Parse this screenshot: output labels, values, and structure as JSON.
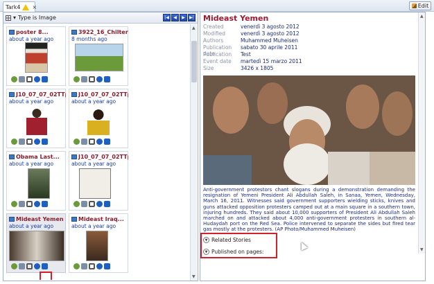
{
  "tab": {
    "label": "Tark4",
    "close": "×"
  },
  "toolbar": {
    "edit_label": "Edit"
  },
  "filter": {
    "label": "Type is Image",
    "prev_first": "|◀",
    "prev": "◀",
    "next": "▶",
    "next_last": "▶|"
  },
  "cards": [
    {
      "title": "poster 8...",
      "age": "about a year ago"
    },
    {
      "title": "3922_16_Chilterns_...",
      "age": "8 months ago"
    },
    {
      "title": "J10_07_07_02TTp0...",
      "age": "about a year ago"
    },
    {
      "title": "J10_07_07_02TTp0...",
      "age": "about a year ago"
    },
    {
      "title": "Obama Last...",
      "age": "about a year ago"
    },
    {
      "title": "J10_07_07_02TTp0...",
      "age": "about a year ago"
    },
    {
      "title": "Mideast Yemen",
      "age": "about a year ago"
    },
    {
      "title": "Mideast Iraq...",
      "age": "about a year ago"
    }
  ],
  "detail": {
    "title": "Mideast Yemen",
    "meta": [
      {
        "key": "Created",
        "value": "venerdì 3 agosto 2012"
      },
      {
        "key": "Modified",
        "value": "venerdì 3 agosto 2012"
      },
      {
        "key": "Authors",
        "value": "Muhammed Muheisen"
      },
      {
        "key": "Publication date",
        "value": "sabato 30 aprile 2011"
      },
      {
        "key": "Publication",
        "value": "Test"
      },
      {
        "key": "Event date",
        "value": "martedì 15 marzo 2011"
      },
      {
        "key": "Size",
        "value": "3426 x 1805"
      }
    ],
    "caption": "Anti-government protestors chant slogans during a demonstration demanding the resignation of Yemeni President Ali Abdullah Saleh, in Sanaa, Yemen, Wednesday, March 16, 2011. Witnesses said government supporters wielding sticks, knives and guns attacked opposition protesters camped out at a main square in a southern town, injuring hundreds. They said about 10,000 supporters of President Ali Abdullah Saleh marched on and attacked about 4,000 anti-government protesters in southern al-Hudaydah port on the Red Sea. Police intervened to separate the sides but fired tear gas mostly at the protesters. (AP Photo/Muhammed Muheisen)",
    "related_label": "Related Stories",
    "published_label": "Published on pages:"
  }
}
